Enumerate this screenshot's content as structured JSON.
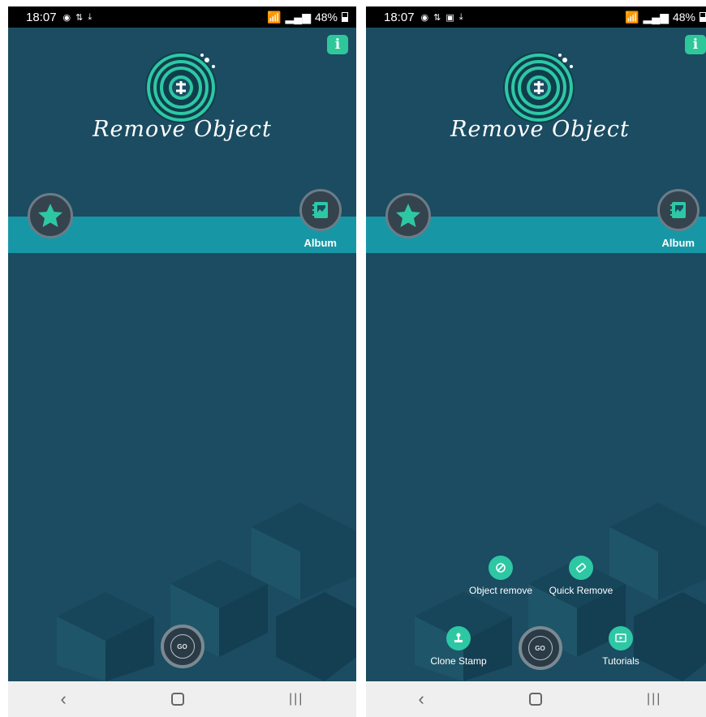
{
  "screens": [
    {
      "id": "left",
      "status": {
        "time": "18:07",
        "battery": "48%"
      },
      "title": "Remove Object",
      "album_label": "Album",
      "go_label": "GO",
      "menu_open": false
    },
    {
      "id": "right",
      "status": {
        "time": "18:07",
        "battery": "48%"
      },
      "title": "Remove Object",
      "album_label": "Album",
      "go_label": "GO",
      "menu_open": true,
      "menu": {
        "object_remove": "Object remove",
        "quick_remove": "Quick Remove",
        "clone_stamp": "Clone Stamp",
        "tutorials": "Tutorials"
      }
    }
  ],
  "colors": {
    "background": "#1b4c61",
    "band": "#1797a6",
    "accent": "#2ec79a"
  },
  "icons": [
    "info-icon",
    "logo-icon",
    "star-icon",
    "album-icon",
    "eraser-icon",
    "clone-stamp-icon",
    "tutorials-icon",
    "back-icon",
    "home-icon",
    "recents-icon"
  ]
}
